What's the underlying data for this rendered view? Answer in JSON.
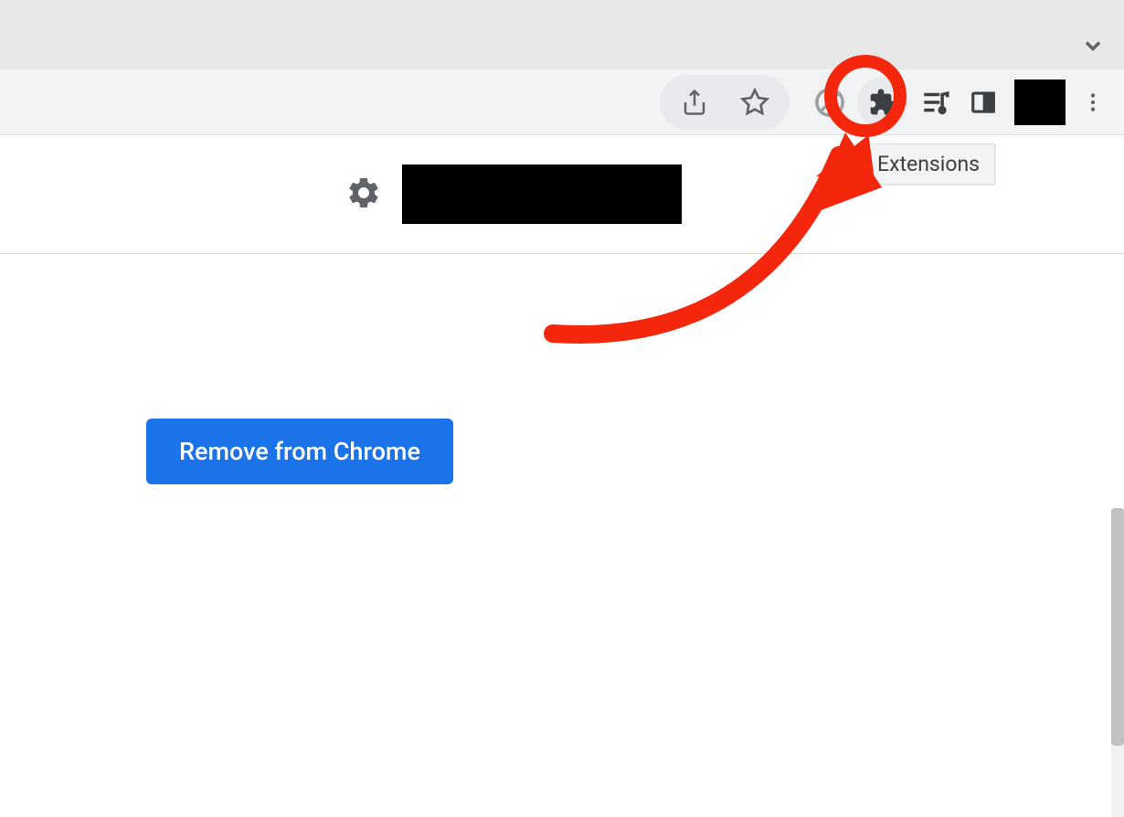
{
  "tooltip": {
    "extensions": "Extensions"
  },
  "buttons": {
    "remove_from_chrome": "Remove from Chrome"
  },
  "annotation": {
    "highlight_color": "#f4270c"
  }
}
